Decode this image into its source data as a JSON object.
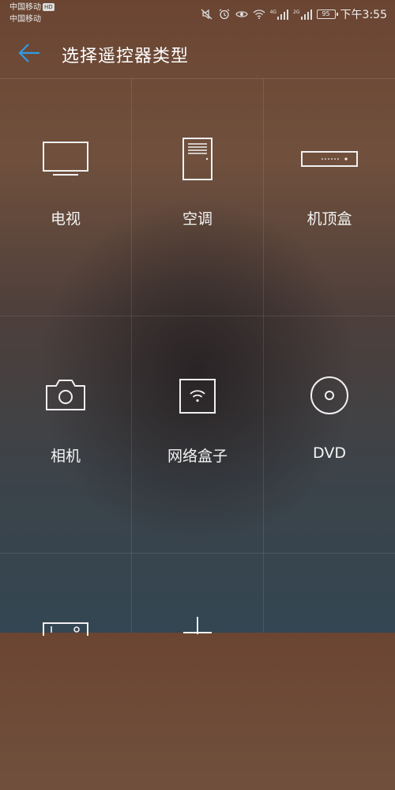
{
  "status_bar": {
    "carrier_1": "中国移动",
    "carrier_1_badge": "HD",
    "carrier_2": "中国移动",
    "network_1": "4G",
    "network_2": "2G",
    "battery": "95",
    "time": "下午3:55",
    "icons": [
      "mute-icon",
      "alarm-icon",
      "eye-comfort-icon",
      "wifi-icon",
      "signal-icon",
      "signal-icon",
      "battery-icon"
    ]
  },
  "toolbar": {
    "back_icon": "arrow-left-icon",
    "title": "选择遥控器类型",
    "accent": "#2f9be6"
  },
  "device_types": [
    {
      "label": "电视",
      "icon": "tv-icon"
    },
    {
      "label": "空调",
      "icon": "air-conditioner-icon"
    },
    {
      "label": "机顶盒",
      "icon": "set-top-box-icon"
    },
    {
      "label": "相机",
      "icon": "camera-icon"
    },
    {
      "label": "网络盒子",
      "icon": "network-box-icon"
    },
    {
      "label": "DVD",
      "icon": "dvd-icon"
    },
    {
      "label": "",
      "icon": "projector-icon"
    },
    {
      "label": "",
      "icon": "fan-icon"
    },
    {
      "label": "",
      "icon": ""
    }
  ]
}
